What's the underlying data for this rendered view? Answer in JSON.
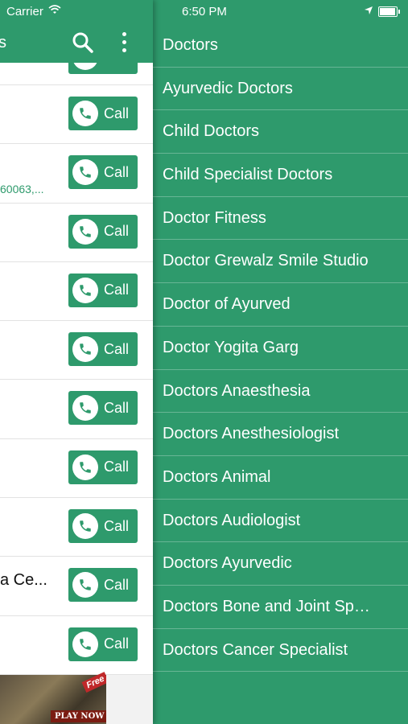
{
  "status_bar": {
    "carrier": "Carrier",
    "time": "6:50 PM"
  },
  "header": {
    "title_fragment": "s"
  },
  "list": {
    "call_label": "Call",
    "row_count": 10,
    "address_fragment": "60063,...",
    "name_fragment": "a Ce..."
  },
  "ad": {
    "badge": "Free",
    "cta": "PLAY NOW"
  },
  "drawer": {
    "items": [
      "Doctors",
      "Ayurvedic Doctors",
      "Child Doctors",
      "Child Specialist Doctors",
      "Doctor Fitness",
      "Doctor Grewalz Smile Studio",
      "Doctor of Ayurved",
      "Doctor Yogita Garg",
      "Doctors Anaesthesia",
      "Doctors Anesthesiologist",
      "Doctors Animal",
      "Doctors Audiologist",
      "Doctors Ayurvedic",
      "Doctors Bone and Joint Sp…",
      "Doctors Cancer Specialist"
    ]
  },
  "colors": {
    "accent": "#2e9a6c",
    "background": "#ffffff"
  },
  "icons": [
    "wifi-icon",
    "search-icon",
    "more-vert-icon",
    "location-arrow-icon",
    "battery-icon",
    "phone-icon"
  ]
}
